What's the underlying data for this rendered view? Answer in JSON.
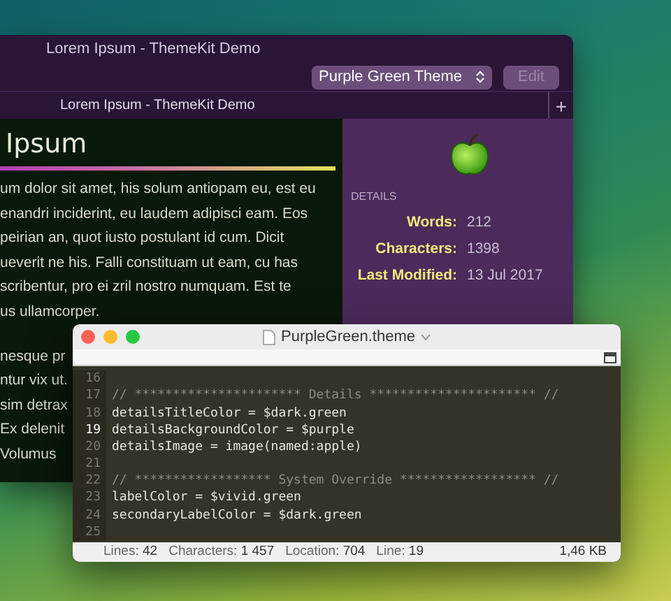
{
  "back_window": {
    "title": "Lorem Ipsum - ThemeKit Demo",
    "theme_select": {
      "value": "Purple Green Theme"
    },
    "edit_button": {
      "label": "Edit",
      "disabled": true
    },
    "tabs": [
      {
        "label": "Lorem Ipsum - ThemeKit Demo",
        "selected": true
      }
    ],
    "add_tab_button": "+",
    "document": {
      "heading": "Ipsum",
      "lines": [
        "um dolor sit amet, his solum antiopam eu, est eu",
        "enandri inciderint, eu laudem adipisci eam. Eos",
        "peirian an, quot iusto postulant id cum. Dicit",
        "ueverit ne his. Falli constituam ut eam, cu has",
        "scribentur, pro ei zril nostro numquam. Est te",
        "us ullamcorper."
      ],
      "lines_after": [
        "nesque pr",
        "ntur vix ut.",
        "sim detrax",
        "Ex delenit",
        "Volumus"
      ]
    },
    "details": {
      "heading": "DETAILS",
      "fields": [
        {
          "label": "Words:",
          "value": "212"
        },
        {
          "label": "Characters:",
          "value": "1398"
        },
        {
          "label": "Last Modified:",
          "value": "13 Jul 2017"
        }
      ]
    }
  },
  "front_window": {
    "title": "PurpleGreen.theme",
    "code_lines": [
      {
        "number": "16"
      },
      {
        "number": "17",
        "kind": "comment",
        "text": "// ********************** Details ********************** //"
      },
      {
        "number": "18",
        "kind": "code",
        "text": "detailsTitleColor = $dark.green"
      },
      {
        "number": "19",
        "kind": "code",
        "text": "detailsBackgroundColor = $purple",
        "selected": true
      },
      {
        "number": "20",
        "kind": "code",
        "text": "detailsImage = image(named:apple)"
      },
      {
        "number": "21"
      },
      {
        "number": "22",
        "kind": "comment",
        "text": "// ****************** System Override ****************** //"
      },
      {
        "number": "23",
        "kind": "code",
        "text": "labelColor = $vivid.green"
      },
      {
        "number": "24",
        "kind": "code",
        "text": "secondaryLabelColor = $dark.green"
      },
      {
        "number": "25"
      }
    ],
    "status": [
      {
        "label": "Lines:",
        "value": "42"
      },
      {
        "label": "Characters:",
        "value": "1 457"
      },
      {
        "label": "Location:",
        "value": "704"
      },
      {
        "label": "Line:",
        "value": "19"
      }
    ],
    "size": "1,46 KB"
  }
}
